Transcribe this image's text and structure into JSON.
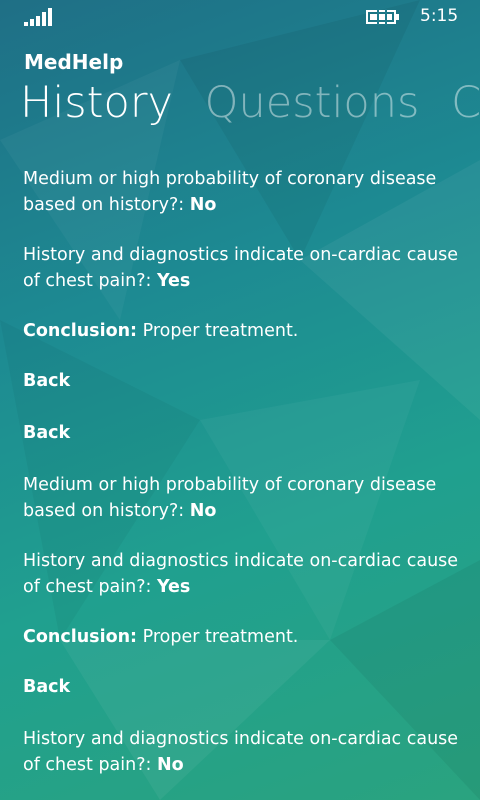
{
  "status": {
    "time": "5:15"
  },
  "app": {
    "title": "MedHelp"
  },
  "pivot": {
    "tabs": [
      "History",
      "Questions",
      "Conclusion"
    ]
  },
  "entries": [
    {
      "q": "Medium or high probability of coronary disease based on history?:",
      "a": "No"
    },
    {
      "q": "History and diagnostics indicate on-cardiac cause of chest pain?:",
      "a": "Yes"
    },
    {
      "label": "Conclusion:",
      "text": "Proper treatment."
    },
    {
      "back": "Back"
    },
    {
      "back": "Back"
    },
    {
      "q": "Medium or high probability of coronary disease based on history?:",
      "a": "No"
    },
    {
      "q": "History and diagnostics indicate on-cardiac cause of chest pain?:",
      "a": "Yes"
    },
    {
      "label": "Conclusion:",
      "text": "Proper treatment."
    },
    {
      "back": "Back"
    },
    {
      "q": "History and diagnostics indicate on-cardiac cause of chest pain?:",
      "a": "No"
    }
  ]
}
